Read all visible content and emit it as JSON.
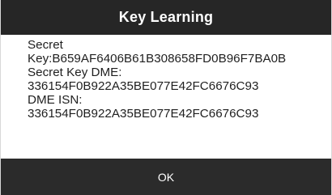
{
  "dialog": {
    "title": "Key Learning",
    "lines": [
      "Secret",
      "Key:B659AF6406B61B308658FD0B96F7BA0B",
      "Secret Key DME:",
      "336154F0B922A35BE077E42FC6676C93",
      "DME ISN:",
      "336154F0B922A35BE077E42FC6676C93"
    ],
    "ok_label": "OK"
  },
  "colors": {
    "title_bar_bg": "#262626",
    "button_bar_bg": "#2b2b2b",
    "text": "#1f1f1f",
    "background": "#ffffff"
  }
}
